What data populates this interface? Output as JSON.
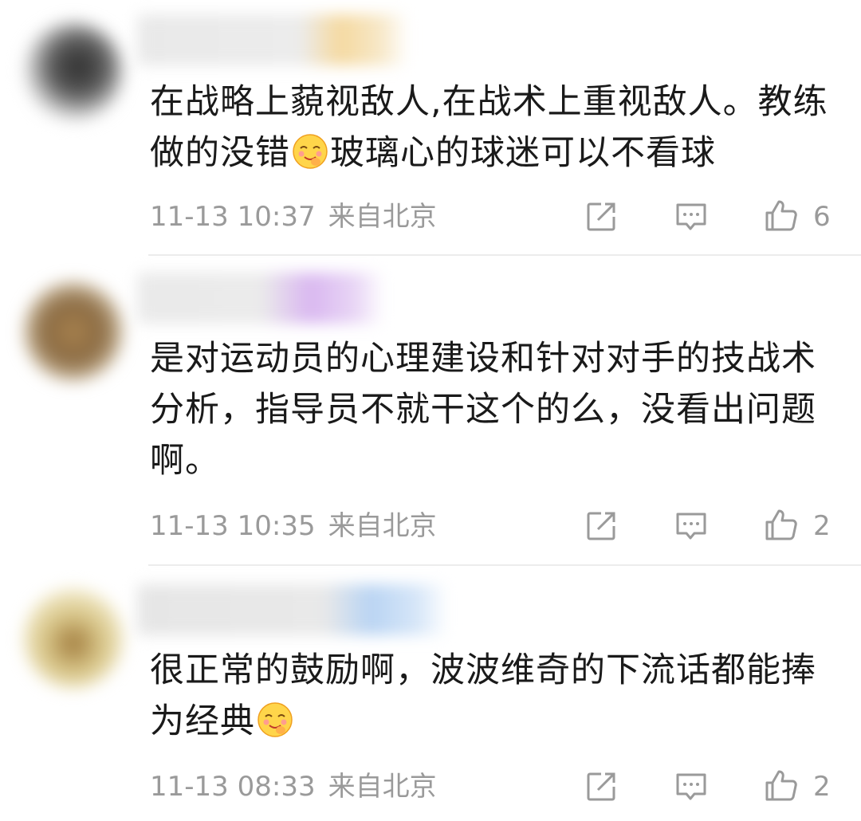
{
  "comments": [
    {
      "text_parts": [
        "在战略上藐视敌人,在战术上重视敌人。教练做的没错",
        "玻璃心的球迷可以不看球"
      ],
      "emoji": "smiling-face-with-hand-on-cheek-emoji",
      "time": "11-13 10:37",
      "location": "来自北京",
      "likes": "6",
      "colors": {
        "avatar": "#2e2e2e",
        "name_accent": "#f5d9a0"
      }
    },
    {
      "text": "是对运动员的心理建设和针对对手的技战术分析，指导员不就干这个的么，没看出问题啊。",
      "time": "11-13 10:35",
      "location": "来自北京",
      "likes": "2",
      "colors": {
        "avatar": "#8a6a42",
        "name_accent": "#d9b7f0"
      }
    },
    {
      "text_parts": [
        "很正常的鼓励啊，波波维奇的下流话都能捧为经典",
        ""
      ],
      "emoji": "smiling-face-with-hand-on-cheek-emoji",
      "time": "11-13 08:33",
      "location": "来自北京",
      "likes": "2",
      "colors": {
        "avatar": "#d9c78a",
        "name_accent": "#b9d4f3"
      }
    }
  ],
  "icons": {
    "share": "share-icon",
    "reply": "comment-icon",
    "like": "thumbs-up-icon"
  }
}
